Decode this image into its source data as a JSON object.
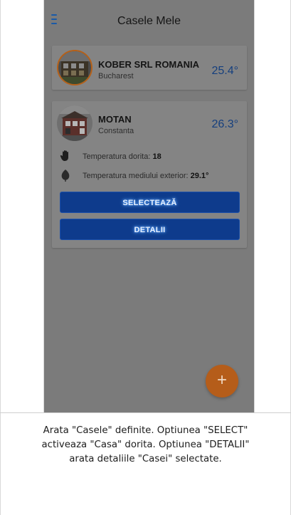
{
  "app": {
    "title": "Casele Mele"
  },
  "houses": [
    {
      "name": "KOBER SRL ROMANIA",
      "city": "Bucharest",
      "temperature": "25.4°"
    },
    {
      "name": "MOTAN",
      "city": "Constanta",
      "temperature": "26.3°",
      "desired_label": "Temperatura dorita:",
      "desired_value": "18",
      "outside_label": "Temperatura mediului exterior:",
      "outside_value": "29.1°",
      "select_label": "SELECTEAZĂ",
      "details_label": "DETALII"
    }
  ],
  "fab": {
    "label": "+"
  },
  "caption": {
    "line1": "Arata \"Casele\" definite. Optiunea \"SELECT\"",
    "line2": "activeaza \"Casa\" dorita.  Optiunea \"DETALII\"",
    "line3": "arata detaliile \"Casei\" selectate."
  },
  "colors": {
    "accent_blue": "#0e3b8c",
    "temp_blue": "#153f7e",
    "fab_orange": "#b55d1a",
    "overlay_gray": "#7b7b7b"
  },
  "icons": [
    "menu-icon",
    "hand-icon",
    "leaf-icon",
    "house-photo",
    "add-icon"
  ]
}
